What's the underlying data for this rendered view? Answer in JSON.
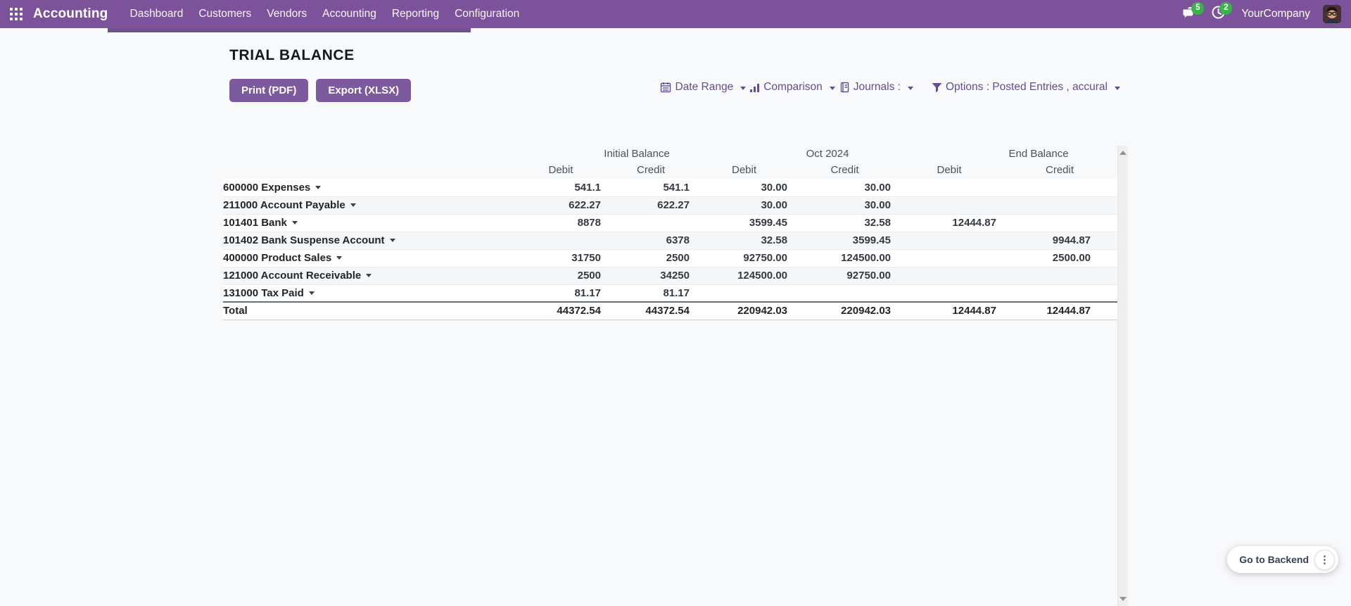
{
  "navbar": {
    "brand": "Accounting",
    "menu_items": [
      "Dashboard",
      "Customers",
      "Vendors",
      "Accounting",
      "Reporting",
      "Configuration"
    ],
    "messages_badge": "5",
    "activities_badge": "2",
    "company": "YourCompany"
  },
  "report": {
    "title": "TRIAL BALANCE",
    "buttons": {
      "print": "Print (PDF)",
      "export": "Export (XLSX)"
    },
    "filters": [
      {
        "icon": "calendar-icon",
        "label": "Date Range"
      },
      {
        "icon": "bar-chart-icon",
        "label": "Comparison"
      },
      {
        "icon": "journal-icon",
        "label": "Journals :"
      },
      {
        "icon": "filter-icon",
        "label": "Options : Posted Entries , accural"
      }
    ]
  },
  "table": {
    "column_groups": [
      "Initial Balance",
      "Oct 2024",
      "End Balance"
    ],
    "sub_headers": [
      "Debit",
      "Credit",
      "Debit",
      "Credit",
      "Debit",
      "Credit"
    ],
    "rows": [
      {
        "account": "600000 Expenses",
        "values": [
          "541.1",
          "541.1",
          "30.00",
          "30.00",
          "",
          ""
        ]
      },
      {
        "account": "211000 Account Payable",
        "values": [
          "622.27",
          "622.27",
          "30.00",
          "30.00",
          "",
          ""
        ]
      },
      {
        "account": "101401 Bank",
        "values": [
          "8878",
          "",
          "3599.45",
          "32.58",
          "12444.87",
          ""
        ]
      },
      {
        "account": "101402 Bank Suspense Account",
        "values": [
          "",
          "6378",
          "32.58",
          "3599.45",
          "",
          "9944.87"
        ]
      },
      {
        "account": "400000 Product Sales",
        "values": [
          "31750",
          "2500",
          "92750.00",
          "124500.00",
          "",
          "2500.00"
        ]
      },
      {
        "account": "121000 Account Receivable",
        "values": [
          "2500",
          "34250",
          "124500.00",
          "92750.00",
          "",
          ""
        ]
      },
      {
        "account": "131000 Tax Paid",
        "values": [
          "81.17",
          "81.17",
          "",
          "",
          "",
          ""
        ]
      }
    ],
    "total": {
      "label": "Total",
      "values": [
        "44372.54",
        "44372.54",
        "220942.03",
        "220942.03",
        "12444.87",
        "12444.87"
      ]
    }
  },
  "floating": {
    "backend_label": "Go to Backend"
  },
  "colors": {
    "navbar_bg": "#7c539b",
    "accent_purple": "#654d93",
    "button_bg": "#7d5a9e",
    "badge_green": "#3ab44a",
    "page_bg": "#f8f9fb"
  }
}
